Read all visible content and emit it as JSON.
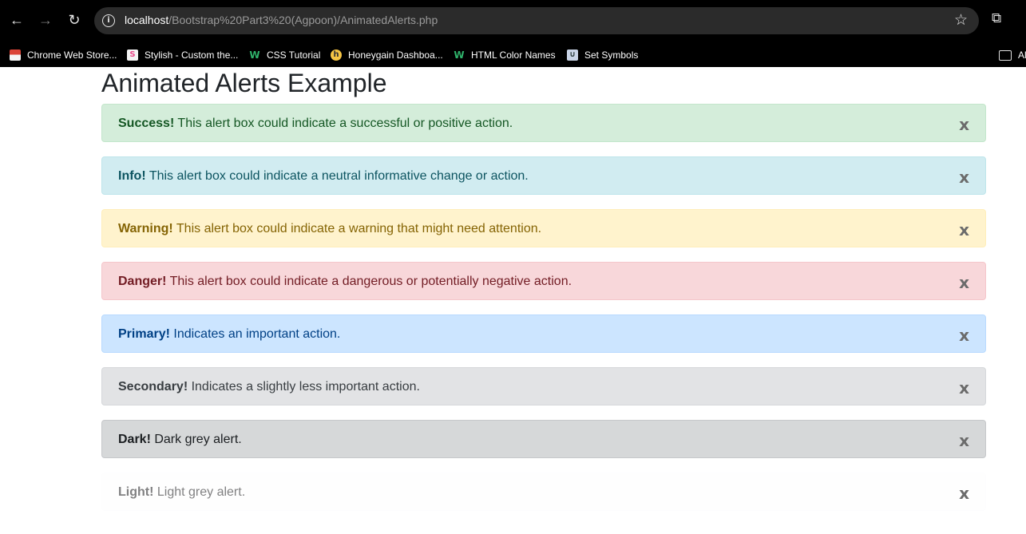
{
  "browser": {
    "url_host": "localhost",
    "url_path": "/Bootstrap%20Part3%20(Agpoon)/AnimatedAlerts.php",
    "nav_icons": {
      "back": "arrow-left-icon",
      "forward": "arrow-right-icon",
      "reload": "reload-icon",
      "info": "info-icon",
      "star": "star-icon",
      "extensions": "puzzle-icon"
    },
    "bookmarks": [
      {
        "label": "Chrome Web Store...",
        "icon": "chrome-web-store-icon"
      },
      {
        "label": "Stylish - Custom the...",
        "icon": "stylish-icon"
      },
      {
        "label": "CSS Tutorial",
        "icon": "w3schools-icon"
      },
      {
        "label": "Honeygain Dashboa...",
        "icon": "honeygain-icon"
      },
      {
        "label": "HTML Color Names",
        "icon": "w3schools-icon"
      },
      {
        "label": "Set Symbols",
        "icon": "set-symbols-icon"
      },
      {
        "label": "Al",
        "icon": "folder-icon"
      }
    ]
  },
  "page": {
    "title": "Animated Alerts Example",
    "close_label": "x",
    "alerts": [
      {
        "type": "success",
        "strong": "Success!",
        "text": " This alert box could indicate a successful or positive action."
      },
      {
        "type": "info",
        "strong": "Info!",
        "text": " This alert box could indicate a neutral informative change or action."
      },
      {
        "type": "warning",
        "strong": "Warning!",
        "text": " This alert box could indicate a warning that might need attention."
      },
      {
        "type": "danger",
        "strong": "Danger!",
        "text": " This alert box could indicate a dangerous or potentially negative action."
      },
      {
        "type": "primary",
        "strong": "Primary!",
        "text": " Indicates an important action."
      },
      {
        "type": "secondary",
        "strong": "Secondary!",
        "text": " Indicates a slightly less important action."
      },
      {
        "type": "dark",
        "strong": "Dark!",
        "text": " Dark grey alert."
      },
      {
        "type": "light",
        "strong": "Light!",
        "text": " Light grey alert."
      }
    ]
  },
  "colors": {
    "chrome_bg": "#000000",
    "omnibox_bg": "#2b2b2b",
    "success_bg": "#d4edda",
    "info_bg": "#d1ecf1",
    "warning_bg": "#fff3cd",
    "danger_bg": "#f8d7da",
    "primary_bg": "#cce5ff",
    "secondary_bg": "#e2e3e5",
    "dark_bg": "#d6d8d9",
    "light_bg": "#fefefe"
  }
}
